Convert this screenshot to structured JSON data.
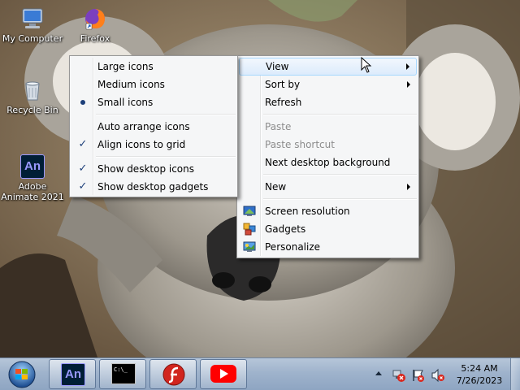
{
  "desktop": {
    "icons": [
      {
        "label": "My Computer"
      },
      {
        "label": "Firefox"
      },
      {
        "label": "Recycle Bin"
      },
      {
        "label": "Adobe Animate 2021",
        "glyph": "An"
      }
    ]
  },
  "context_menu": {
    "items": [
      {
        "label": "View",
        "submenu": true,
        "hovered": true
      },
      {
        "label": "Sort by",
        "submenu": true
      },
      {
        "label": "Refresh"
      },
      {
        "label": "Paste",
        "disabled": true
      },
      {
        "label": "Paste shortcut",
        "disabled": true
      },
      {
        "label": "Next desktop background"
      },
      {
        "label": "New",
        "submenu": true
      },
      {
        "label": "Screen resolution",
        "icon": "screen-resolution-icon"
      },
      {
        "label": "Gadgets",
        "icon": "gadgets-icon"
      },
      {
        "label": "Personalize",
        "icon": "personalize-icon"
      }
    ]
  },
  "view_submenu": {
    "items": [
      {
        "label": "Large icons"
      },
      {
        "label": "Medium icons"
      },
      {
        "label": "Small icons",
        "selected": true
      },
      {
        "label": "Auto arrange icons"
      },
      {
        "label": "Align icons to grid",
        "checked": true
      },
      {
        "label": "Show desktop icons",
        "checked": true
      },
      {
        "label": "Show desktop gadgets",
        "checked": true
      }
    ]
  },
  "taskbar": {
    "pinned": [
      {
        "name": "Adobe Animate",
        "glyph": "An"
      },
      {
        "name": "Command Prompt",
        "glyph": "C:\\_"
      },
      {
        "name": "Adobe Flash"
      },
      {
        "name": "YouTube"
      }
    ],
    "clock": {
      "time": "5:24 AM",
      "date": "7/26/2023"
    }
  },
  "colors": {
    "menu_bg": "#f5f6f7",
    "hover": "#dcebfc",
    "taskbar": "#9fb3cc",
    "animate_bg": "#001e36",
    "animate_fg": "#9999ff",
    "youtube": "#ff0000"
  }
}
